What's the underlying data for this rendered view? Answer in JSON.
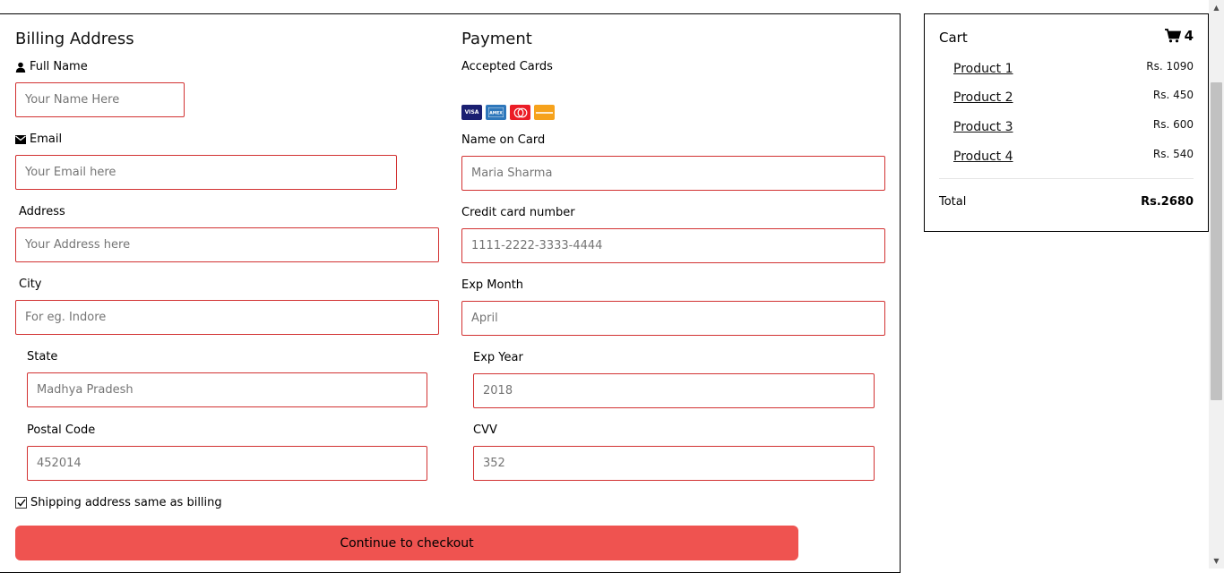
{
  "billing": {
    "heading": "Billing Address",
    "full_name_label": "Full Name",
    "full_name_placeholder": "Your Name Here",
    "email_label": "Email",
    "email_placeholder": "Your Email here",
    "address_label": "Address",
    "address_placeholder": "Your Address here",
    "city_label": "City",
    "city_placeholder": "For eg. Indore",
    "state_label": "State",
    "state_placeholder": "Madhya Pradesh",
    "postal_label": "Postal Code",
    "postal_placeholder": "452014"
  },
  "payment": {
    "heading": "Payment",
    "accepted_label": "Accepted Cards",
    "cards": [
      "VISA",
      "AMEX",
      "MC",
      "DISCOVER"
    ],
    "name_label": "Name on Card",
    "name_placeholder": "Maria Sharma",
    "cc_label": "Credit card number",
    "cc_placeholder": "1111-2222-3333-4444",
    "exp_month_label": "Exp Month",
    "exp_month_placeholder": "April",
    "exp_year_label": "Exp Year",
    "exp_year_placeholder": "2018",
    "cvv_label": "CVV",
    "cvv_placeholder": "352"
  },
  "shipping_same_label": "Shipping address same as billing",
  "checkout_label": "Continue to checkout",
  "cart": {
    "title": "Cart",
    "count": "4",
    "items": [
      {
        "name": "Product 1",
        "price": "Rs. 1090"
      },
      {
        "name": "Product 2",
        "price": "Rs. 450"
      },
      {
        "name": "Product 3",
        "price": "Rs. 600"
      },
      {
        "name": "Product 4",
        "price": "Rs. 540"
      }
    ],
    "total_label": "Total",
    "total_value": "Rs.2680"
  },
  "colors": {
    "accent": "#ef5350",
    "field_border": "#d23232"
  },
  "icons": {
    "user": "user-icon",
    "email": "envelope-icon",
    "cart": "shopping-cart-icon",
    "checkbox": "checkbox-checked"
  }
}
